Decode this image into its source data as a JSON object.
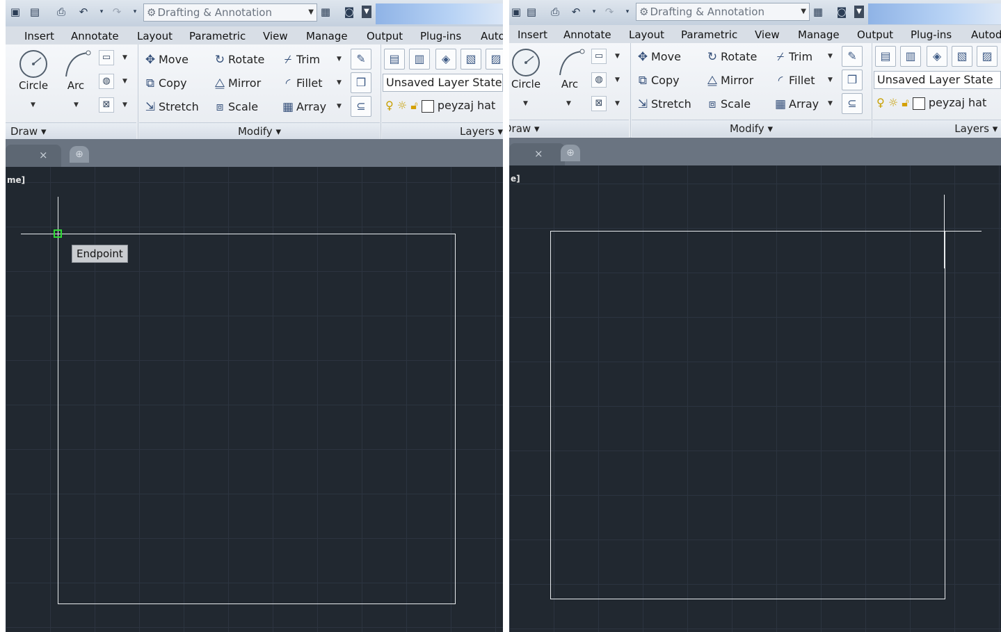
{
  "workspace": "Drafting & Annotation",
  "tabs": [
    "Insert",
    "Annotate",
    "Layout",
    "Parametric",
    "View",
    "Manage",
    "Output",
    "Plug-ins",
    "Autodesk"
  ],
  "draw": {
    "circle": "Circle",
    "arc": "Arc",
    "panel": "Draw"
  },
  "modify": {
    "move": "Move",
    "rotate": "Rotate",
    "trim": "Trim",
    "copy": "Copy",
    "mirror": "Mirror",
    "fillet": "Fillet",
    "stretch": "Stretch",
    "scale": "Scale",
    "array": "Array",
    "panel": "Modify"
  },
  "layers": {
    "state": "Unsaved Layer State",
    "current": "peyzaj hat",
    "panel": "Layers"
  },
  "viewport_label": "me]",
  "viewport_label_right": "e]",
  "tooltip": "Endpoint",
  "colors": {
    "canvas": "#212830",
    "snap_marker": "#2fdc36"
  }
}
